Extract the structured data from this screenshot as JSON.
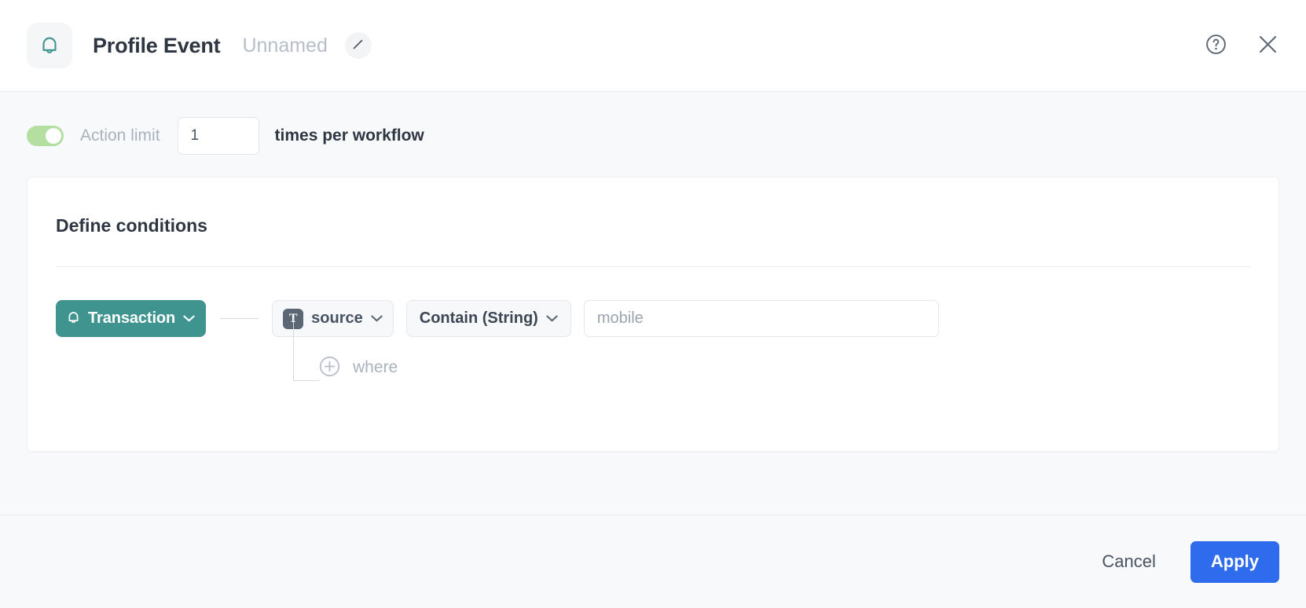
{
  "header": {
    "app_icon": "bell-icon",
    "title": "Profile Event",
    "subtitle": "Unnamed",
    "edit_icon": "pencil-icon",
    "help_icon": "help-circle-icon",
    "close_icon": "close-icon"
  },
  "action_limit": {
    "toggle_state": "on",
    "label": "Action limit",
    "value": "1",
    "suffix": "times per workflow"
  },
  "conditions": {
    "title": "Define conditions",
    "event_chip": {
      "icon": "bell-icon",
      "label": "Transaction",
      "chevron": "chevron-down-icon",
      "color": "#3f9490"
    },
    "property": {
      "type_badge": "T",
      "label": "source",
      "chevron": "chevron-down-icon"
    },
    "operator": {
      "label": "Contain (String)",
      "chevron": "chevron-down-icon"
    },
    "value_input": {
      "value": "",
      "placeholder": "mobile"
    },
    "add_where": {
      "icon": "plus-circle-icon",
      "label": "where"
    }
  },
  "footer": {
    "cancel_label": "Cancel",
    "apply_label": "Apply",
    "apply_color": "#2f6bed"
  }
}
